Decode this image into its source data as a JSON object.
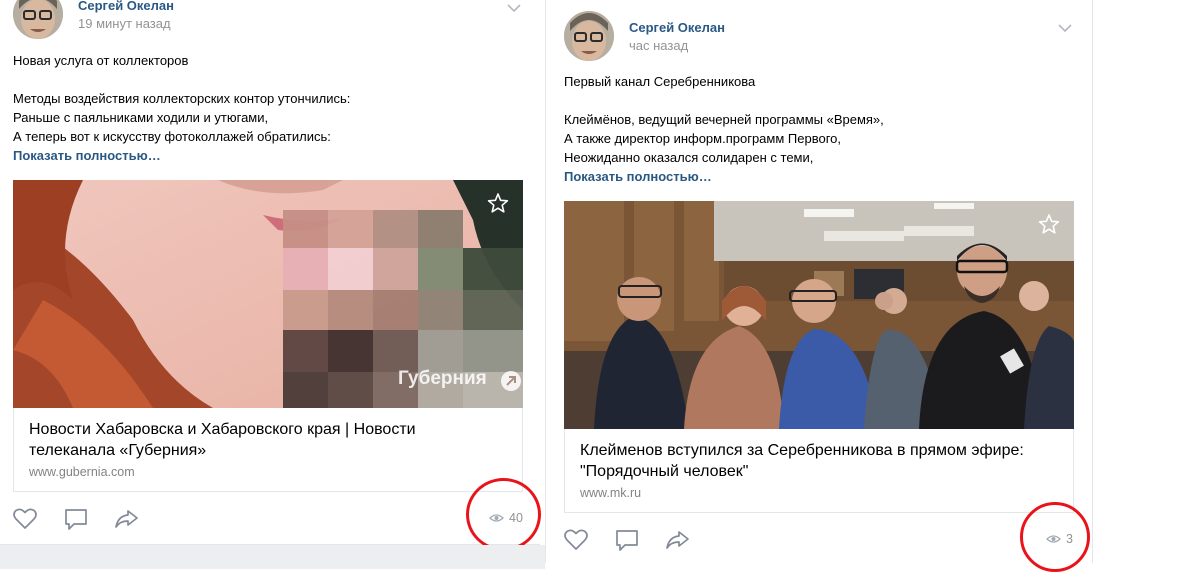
{
  "posts": [
    {
      "author": "Сергей Окелан",
      "time": "19 минут назад",
      "text": "Новая услуга от коллекторов\n\nМетоды воздействия коллекторских контор утончились:\nРаньше с паяльниками ходили и утюгами,\nА теперь вот к искусству фотоколлажей обратились:",
      "show_more": "Показать полностью…",
      "media": {
        "watermark": "Губерния"
      },
      "link": {
        "title": "Новости Хабаровска и Хабаровского края | Новости телеканала «Губерния»",
        "domain": "www.gubernia.com"
      },
      "views": "40",
      "icons": [
        "heart-icon",
        "comment-icon",
        "share-icon",
        "eye-icon",
        "star-icon",
        "chevron-down-icon"
      ]
    },
    {
      "author": "Сергей Окелан",
      "time": "час назад",
      "text": "Первый канал Серебренникова\n\nКлеймёнов, ведущий вечерней программы «Время»,\nА также директор информ.программ Первого,\nНеожиданно оказался солидарен с теми,",
      "show_more": "Показать полностью…",
      "link": {
        "title": "Клейменов вступился за Серебренникова в прямом эфире: \"Порядочный человек\"",
        "domain": "www.mk.ru"
      },
      "views": "3",
      "icons": [
        "heart-icon",
        "comment-icon",
        "share-icon",
        "eye-icon",
        "star-icon",
        "chevron-down-icon"
      ]
    }
  ],
  "colors": {
    "link_blue": "#2a5885",
    "muted": "#939393",
    "annotation_red": "#e8141a"
  }
}
